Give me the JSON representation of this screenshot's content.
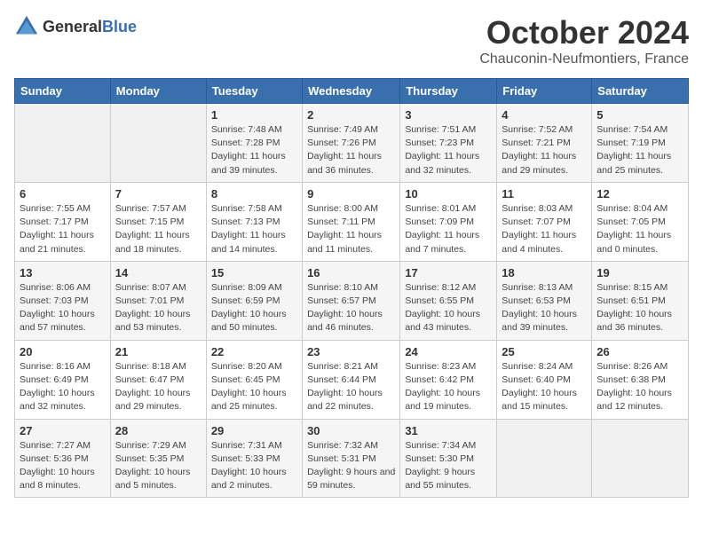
{
  "logo": {
    "general": "General",
    "blue": "Blue"
  },
  "title": "October 2024",
  "subtitle": "Chauconin-Neufmontiers, France",
  "headers": [
    "Sunday",
    "Monday",
    "Tuesday",
    "Wednesday",
    "Thursday",
    "Friday",
    "Saturday"
  ],
  "weeks": [
    [
      {
        "day": "",
        "info": ""
      },
      {
        "day": "",
        "info": ""
      },
      {
        "day": "1",
        "info": "Sunrise: 7:48 AM\nSunset: 7:28 PM\nDaylight: 11 hours and 39 minutes."
      },
      {
        "day": "2",
        "info": "Sunrise: 7:49 AM\nSunset: 7:26 PM\nDaylight: 11 hours and 36 minutes."
      },
      {
        "day": "3",
        "info": "Sunrise: 7:51 AM\nSunset: 7:23 PM\nDaylight: 11 hours and 32 minutes."
      },
      {
        "day": "4",
        "info": "Sunrise: 7:52 AM\nSunset: 7:21 PM\nDaylight: 11 hours and 29 minutes."
      },
      {
        "day": "5",
        "info": "Sunrise: 7:54 AM\nSunset: 7:19 PM\nDaylight: 11 hours and 25 minutes."
      }
    ],
    [
      {
        "day": "6",
        "info": "Sunrise: 7:55 AM\nSunset: 7:17 PM\nDaylight: 11 hours and 21 minutes."
      },
      {
        "day": "7",
        "info": "Sunrise: 7:57 AM\nSunset: 7:15 PM\nDaylight: 11 hours and 18 minutes."
      },
      {
        "day": "8",
        "info": "Sunrise: 7:58 AM\nSunset: 7:13 PM\nDaylight: 11 hours and 14 minutes."
      },
      {
        "day": "9",
        "info": "Sunrise: 8:00 AM\nSunset: 7:11 PM\nDaylight: 11 hours and 11 minutes."
      },
      {
        "day": "10",
        "info": "Sunrise: 8:01 AM\nSunset: 7:09 PM\nDaylight: 11 hours and 7 minutes."
      },
      {
        "day": "11",
        "info": "Sunrise: 8:03 AM\nSunset: 7:07 PM\nDaylight: 11 hours and 4 minutes."
      },
      {
        "day": "12",
        "info": "Sunrise: 8:04 AM\nSunset: 7:05 PM\nDaylight: 11 hours and 0 minutes."
      }
    ],
    [
      {
        "day": "13",
        "info": "Sunrise: 8:06 AM\nSunset: 7:03 PM\nDaylight: 10 hours and 57 minutes."
      },
      {
        "day": "14",
        "info": "Sunrise: 8:07 AM\nSunset: 7:01 PM\nDaylight: 10 hours and 53 minutes."
      },
      {
        "day": "15",
        "info": "Sunrise: 8:09 AM\nSunset: 6:59 PM\nDaylight: 10 hours and 50 minutes."
      },
      {
        "day": "16",
        "info": "Sunrise: 8:10 AM\nSunset: 6:57 PM\nDaylight: 10 hours and 46 minutes."
      },
      {
        "day": "17",
        "info": "Sunrise: 8:12 AM\nSunset: 6:55 PM\nDaylight: 10 hours and 43 minutes."
      },
      {
        "day": "18",
        "info": "Sunrise: 8:13 AM\nSunset: 6:53 PM\nDaylight: 10 hours and 39 minutes."
      },
      {
        "day": "19",
        "info": "Sunrise: 8:15 AM\nSunset: 6:51 PM\nDaylight: 10 hours and 36 minutes."
      }
    ],
    [
      {
        "day": "20",
        "info": "Sunrise: 8:16 AM\nSunset: 6:49 PM\nDaylight: 10 hours and 32 minutes."
      },
      {
        "day": "21",
        "info": "Sunrise: 8:18 AM\nSunset: 6:47 PM\nDaylight: 10 hours and 29 minutes."
      },
      {
        "day": "22",
        "info": "Sunrise: 8:20 AM\nSunset: 6:45 PM\nDaylight: 10 hours and 25 minutes."
      },
      {
        "day": "23",
        "info": "Sunrise: 8:21 AM\nSunset: 6:44 PM\nDaylight: 10 hours and 22 minutes."
      },
      {
        "day": "24",
        "info": "Sunrise: 8:23 AM\nSunset: 6:42 PM\nDaylight: 10 hours and 19 minutes."
      },
      {
        "day": "25",
        "info": "Sunrise: 8:24 AM\nSunset: 6:40 PM\nDaylight: 10 hours and 15 minutes."
      },
      {
        "day": "26",
        "info": "Sunrise: 8:26 AM\nSunset: 6:38 PM\nDaylight: 10 hours and 12 minutes."
      }
    ],
    [
      {
        "day": "27",
        "info": "Sunrise: 7:27 AM\nSunset: 5:36 PM\nDaylight: 10 hours and 8 minutes."
      },
      {
        "day": "28",
        "info": "Sunrise: 7:29 AM\nSunset: 5:35 PM\nDaylight: 10 hours and 5 minutes."
      },
      {
        "day": "29",
        "info": "Sunrise: 7:31 AM\nSunset: 5:33 PM\nDaylight: 10 hours and 2 minutes."
      },
      {
        "day": "30",
        "info": "Sunrise: 7:32 AM\nSunset: 5:31 PM\nDaylight: 9 hours and 59 minutes."
      },
      {
        "day": "31",
        "info": "Sunrise: 7:34 AM\nSunset: 5:30 PM\nDaylight: 9 hours and 55 minutes."
      },
      {
        "day": "",
        "info": ""
      },
      {
        "day": "",
        "info": ""
      }
    ]
  ]
}
